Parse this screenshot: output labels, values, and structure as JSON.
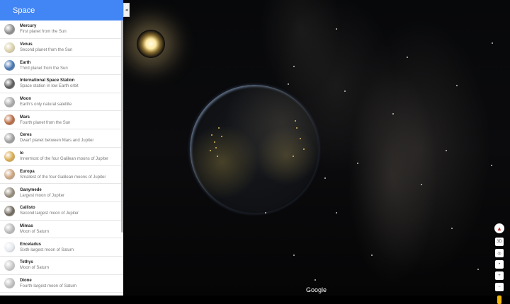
{
  "panel": {
    "title": "Space",
    "collapse_icon": "◂",
    "items": [
      {
        "name": "Mercury",
        "desc": "First planet from the Sun",
        "color": "#8a8a8a"
      },
      {
        "name": "Venus",
        "desc": "Second planet from the Sun",
        "color": "#d9cfa8"
      },
      {
        "name": "Earth",
        "desc": "Third planet from the Sun",
        "color": "#3f6fae"
      },
      {
        "name": "International Space Station",
        "desc": "Space station in low Earth orbit",
        "color": "#555"
      },
      {
        "name": "Moon",
        "desc": "Earth's only natural satellite",
        "color": "#a6a6a6"
      },
      {
        "name": "Mars",
        "desc": "Fourth planet from the Sun",
        "color": "#b5653c"
      },
      {
        "name": "Ceres",
        "desc": "Dwarf planet between Mars and Jupiter",
        "color": "#9b9b9b"
      },
      {
        "name": "Io",
        "desc": "Innermost of the four Galilean moons of Jupiter",
        "color": "#d7a84a"
      },
      {
        "name": "Europa",
        "desc": "Smallest of the four Galilean moons of Jupiter",
        "color": "#c9a07a"
      },
      {
        "name": "Ganymede",
        "desc": "Largest moon of Jupiter",
        "color": "#8f8575"
      },
      {
        "name": "Callisto",
        "desc": "Second largest moon of Jupiter",
        "color": "#6b6358"
      },
      {
        "name": "Mimas",
        "desc": "Moon of Saturn",
        "color": "#b8b8b8"
      },
      {
        "name": "Enceladus",
        "desc": "Sixth-largest moon of Saturn",
        "color": "#e6e9ee"
      },
      {
        "name": "Tethys",
        "desc": "Moon of Saturn",
        "color": "#c8c8c8"
      },
      {
        "name": "Dione",
        "desc": "Fourth-largest moon of Saturn",
        "color": "#bdbdbd"
      }
    ]
  },
  "controls": {
    "compass_icon": "▲",
    "view_3d": "3D",
    "earth_icon": "◎",
    "recenter_icon": "•",
    "zoom_in": "+",
    "zoom_out": "−"
  },
  "footer": {
    "logo": "Google"
  }
}
